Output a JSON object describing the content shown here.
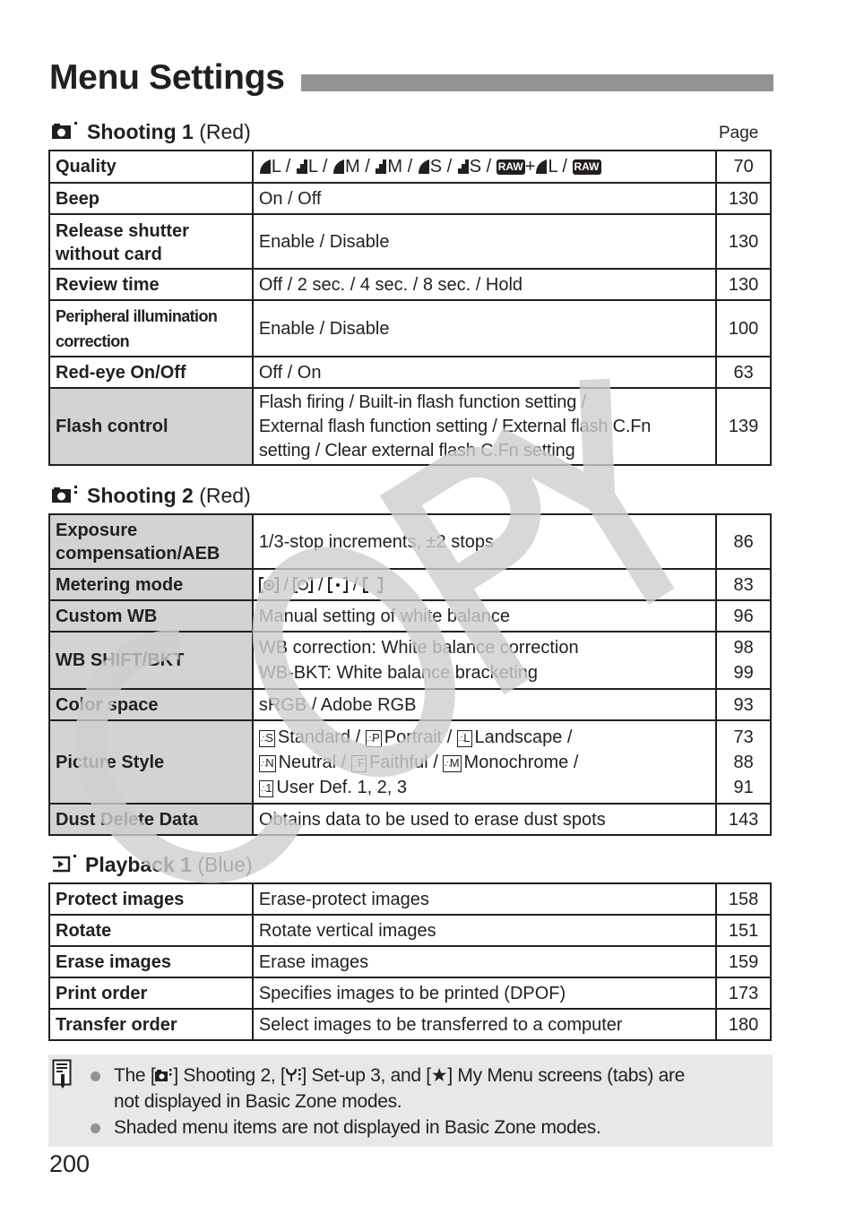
{
  "page": {
    "title": "Menu Settings",
    "page_column_label": "Page",
    "page_number": "200",
    "watermark_text": "COPY"
  },
  "colors": {
    "text": "#231f20",
    "title_bar": "#939393",
    "shaded_cell": "#d3d3d3",
    "note_background": "#e8e8e8",
    "watermark": "#cfcfcf"
  },
  "sections": {
    "shooting1": {
      "icon": "camera-tab-1-icon",
      "title": "Shooting 1",
      "color_label": "(Red)",
      "rows": [
        {
          "label": "Quality",
          "shaded": false,
          "value_type": "quality-icons",
          "quality_options": [
            "L",
            "L",
            "M",
            "M",
            "S",
            "S"
          ],
          "quality_sep": "/",
          "raw_label": "RAW",
          "plus": "+",
          "raw_plus_size": "L",
          "pages": [
            "70"
          ]
        },
        {
          "label": "Beep",
          "shaded": false,
          "values": [
            "On / Off"
          ],
          "pages": [
            "130"
          ]
        },
        {
          "label_lines": [
            "Release shutter",
            "without card"
          ],
          "shaded": false,
          "values": [
            "Enable / Disable"
          ],
          "pages": [
            "130"
          ]
        },
        {
          "label": "Review time",
          "shaded": false,
          "values": [
            "Off / 2 sec. / 4 sec. / 8 sec. / Hold"
          ],
          "pages": [
            "130"
          ]
        },
        {
          "label_lines": [
            "Peripheral illumination",
            "correction"
          ],
          "shaded": false,
          "values": [
            "Enable / Disable"
          ],
          "pages": [
            "100"
          ]
        },
        {
          "label": "Red-eye On/Off",
          "shaded": false,
          "values": [
            "Off / On"
          ],
          "pages": [
            "63"
          ]
        },
        {
          "label": "Flash control",
          "shaded": true,
          "values": [
            "Flash firing / Built-in flash function setting /",
            "External flash function setting / External flash C.Fn",
            "setting / Clear external flash C.Fn setting"
          ],
          "pages": [
            "139"
          ]
        }
      ]
    },
    "shooting2": {
      "icon": "camera-tab-2-icon",
      "title": "Shooting 2",
      "color_label": "(Red)",
      "rows": [
        {
          "label_lines": [
            "Exposure",
            "compensation/AEB"
          ],
          "shaded": true,
          "values": [
            "1/3-stop increments, ±2 stops"
          ],
          "pages": [
            "86"
          ]
        },
        {
          "label": "Metering mode",
          "shaded": true,
          "value_type": "metering-icons",
          "metering_modes": [
            "evaluative-metering-icon",
            "partial-metering-icon",
            "spot-metering-icon",
            "center-weighted-metering-icon"
          ],
          "pages": [
            "83"
          ]
        },
        {
          "label": "Custom WB",
          "shaded": true,
          "values": [
            "Manual setting of white balance"
          ],
          "pages": [
            "96"
          ]
        },
        {
          "label": "WB SHIFT/BKT",
          "shaded": true,
          "values": [
            "WB correction: White balance correction",
            "WB-BKT: White balance bracketing"
          ],
          "pages": [
            "98",
            "99"
          ]
        },
        {
          "label": "Color space",
          "shaded": true,
          "values": [
            "sRGB / Adobe RGB"
          ],
          "pages": [
            "93"
          ]
        },
        {
          "label": "Picture Style",
          "shaded": true,
          "value_type": "picture-styles",
          "styles": [
            {
              "code": "S",
              "name": "Standard"
            },
            {
              "code": "P",
              "name": "Portrait"
            },
            {
              "code": "L",
              "name": "Landscape"
            },
            {
              "code": "N",
              "name": "Neutral"
            },
            {
              "code": "F",
              "name": "Faithful"
            },
            {
              "code": "M",
              "name": "Monochrome"
            },
            {
              "code": "1",
              "name": "User Def. 1, 2, 3"
            }
          ],
          "pages": [
            "73",
            "88",
            "91"
          ]
        },
        {
          "label": "Dust Delete Data",
          "shaded": true,
          "values": [
            "Obtains data to be used to erase dust spots"
          ],
          "pages": [
            "143"
          ]
        }
      ]
    },
    "playback1": {
      "icon": "playback-tab-1-icon",
      "title": "Playback 1",
      "color_label": "(Blue)",
      "rows": [
        {
          "label": "Protect images",
          "shaded": false,
          "values": [
            "Erase-protect images"
          ],
          "pages": [
            "158"
          ]
        },
        {
          "label": "Rotate",
          "shaded": false,
          "values": [
            "Rotate vertical images"
          ],
          "pages": [
            "151"
          ]
        },
        {
          "label": "Erase images",
          "shaded": false,
          "values": [
            "Erase images"
          ],
          "pages": [
            "159"
          ]
        },
        {
          "label": "Print order",
          "shaded": false,
          "values": [
            "Specifies images to be printed (DPOF)"
          ],
          "pages": [
            "173"
          ]
        },
        {
          "label": "Transfer order",
          "shaded": false,
          "values": [
            "Select images to be transferred to a computer"
          ],
          "pages": [
            "180"
          ]
        }
      ]
    }
  },
  "note": {
    "icon": "memo-icon",
    "items": [
      {
        "parts": [
          "The [",
          "] Shooting 2, [",
          "] Set-up 3, and [",
          "] My Menu screens (tabs) are"
        ],
        "second_line": "not displayed in Basic Zone modes.",
        "inline_icons": [
          "camera-tab-2-icon",
          "setup-tab-3-icon",
          "star-icon"
        ]
      },
      {
        "text": "Shaded menu items are not displayed in Basic Zone modes."
      }
    ]
  }
}
